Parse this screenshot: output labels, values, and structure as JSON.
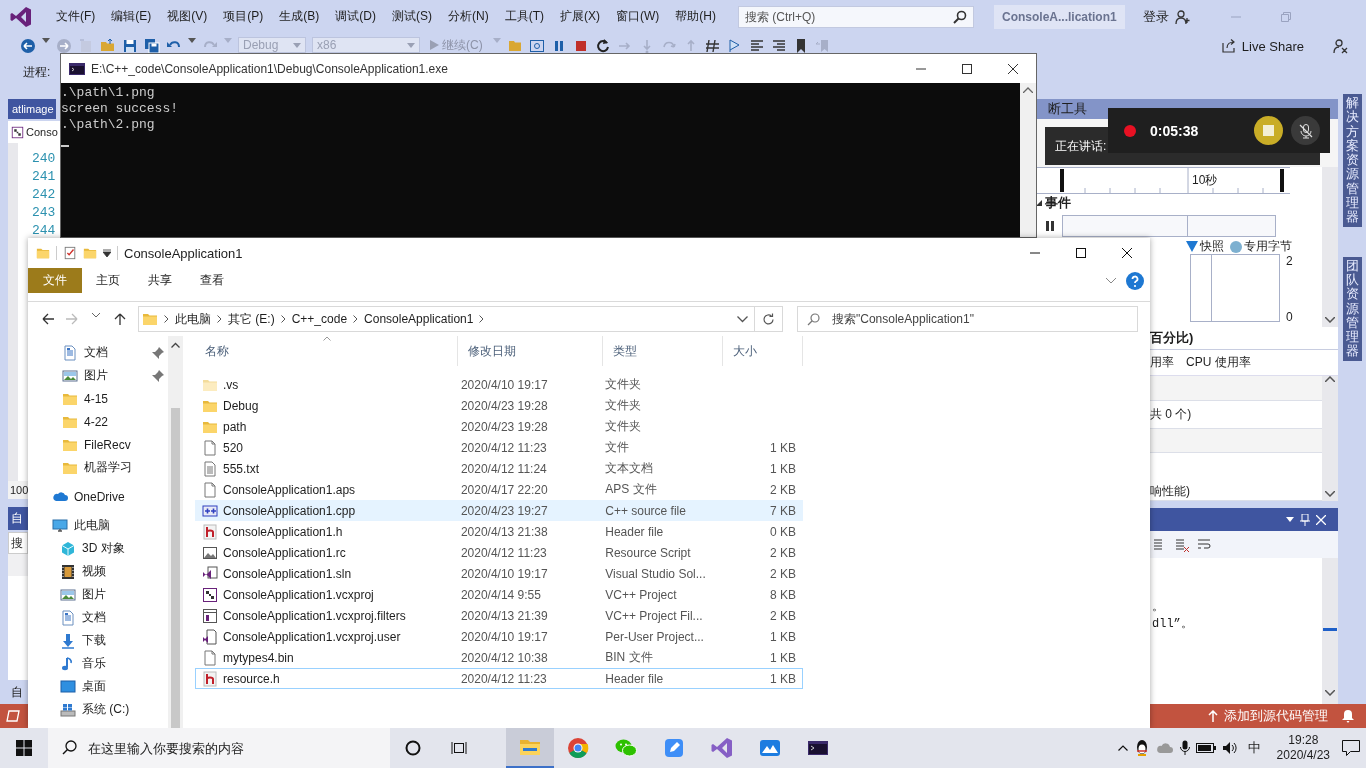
{
  "visual_studio": {
    "menu": [
      "文件(F)",
      "编辑(E)",
      "视图(V)",
      "项目(P)",
      "生成(B)",
      "调试(D)",
      "测试(S)",
      "分析(N)",
      "工具(T)",
      "扩展(X)",
      "窗口(W)",
      "帮助(H)"
    ],
    "search": {
      "placeholder": "搜索 (Ctrl+Q)"
    },
    "solution_name": "ConsoleA...lication1",
    "sign_in": "登录",
    "toolbar": {
      "configuration": {
        "value": "Debug",
        "disabled": true
      },
      "platform": {
        "value": "x86",
        "disabled": true
      },
      "continue": {
        "label": "继续(C)",
        "disabled": true
      },
      "live_share": "Live Share"
    },
    "process_label": "进程:",
    "editor": {
      "document_tab": "atlimage",
      "file_selector": "Conso",
      "line_numbers": [
        "240",
        "241",
        "242",
        "243",
        "244"
      ],
      "zoom": "100"
    },
    "autos_panel": {
      "title": "自",
      "search": {
        "placeholder": "搜"
      }
    },
    "bottom_tab": "自",
    "diagnostics": {
      "title": "断工具",
      "time_label": "10秒",
      "events_label": "事件",
      "legend": [
        {
          "label": "快照",
          "kind": "triangle",
          "color": "#1e78d2"
        },
        {
          "label": "专用字节",
          "kind": "dot",
          "color": "#7db0d0"
        }
      ],
      "axis_labels": [
        "2",
        "0"
      ],
      "section_label": "百分比)",
      "tabs": [
        "用率",
        "CPU 使用率"
      ],
      "summary": "共 0 个)",
      "footer": "响性能)"
    },
    "output_lines": [
      "。",
      "dll”。"
    ],
    "side_tabs": [
      "解决方案资源管理器",
      "团队资源管理器"
    ],
    "status": "添加到源代码管理"
  },
  "console": {
    "title": "E:\\C++_code\\ConsoleApplication1\\Debug\\ConsoleApplication1.exe",
    "lines": [
      ".\\path\\1.png",
      "screen success!",
      ".\\path\\2.png"
    ]
  },
  "recorder": {
    "speaking_label": "正在讲话:",
    "elapsed": "0:05:38",
    "recording": true,
    "mic_muted": true
  },
  "explorer": {
    "title": "ConsoleApplication1",
    "ribbon_tabs": [
      {
        "label": "文件",
        "kind": "file-menu"
      },
      {
        "label": "主页",
        "kind": "tab"
      },
      {
        "label": "共享",
        "kind": "tab"
      },
      {
        "label": "查看",
        "kind": "tab"
      }
    ],
    "address": [
      "此电脑",
      "其它 (E:)",
      "C++_code",
      "ConsoleApplication1"
    ],
    "search": {
      "placeholder": "搜索\"ConsoleApplication1\""
    },
    "quick_access": [
      {
        "label": "文档",
        "kind": "documents",
        "pinned": true
      },
      {
        "label": "图片",
        "kind": "pictures",
        "pinned": true
      },
      {
        "label": "4-15",
        "kind": "folder",
        "pinned": false
      },
      {
        "label": "4-22",
        "kind": "folder",
        "pinned": false
      },
      {
        "label": "FileRecv",
        "kind": "folder",
        "pinned": false
      },
      {
        "label": "机器学习",
        "kind": "folder",
        "pinned": false
      }
    ],
    "nav": [
      {
        "label": "OneDrive",
        "kind": "onedrive"
      },
      {
        "label": "此电脑",
        "kind": "pc",
        "children": [
          {
            "label": "3D 对象",
            "kind": "objects"
          },
          {
            "label": "视频",
            "kind": "videos"
          },
          {
            "label": "图片",
            "kind": "pictures"
          },
          {
            "label": "文档",
            "kind": "documents"
          },
          {
            "label": "下载",
            "kind": "downloads"
          },
          {
            "label": "音乐",
            "kind": "music"
          },
          {
            "label": "桌面",
            "kind": "desktop"
          },
          {
            "label": "系统 (C:)",
            "kind": "drive"
          }
        ]
      }
    ],
    "columns": [
      "名称",
      "修改日期",
      "类型",
      "大小"
    ],
    "files": [
      {
        "name": ".vs",
        "modified": "2020/4/10 19:17",
        "type": "文件夹",
        "kind": "folder-hidden",
        "selected": false,
        "focused": false
      },
      {
        "name": "Debug",
        "modified": "2020/4/23 19:28",
        "type": "文件夹",
        "kind": "folder",
        "selected": false,
        "focused": false
      },
      {
        "name": "path",
        "modified": "2020/4/23 19:28",
        "type": "文件夹",
        "kind": "folder",
        "selected": false,
        "focused": false
      },
      {
        "name": "520",
        "modified": "2020/4/12 11:23",
        "type": "文件",
        "size": "1 KB",
        "kind": "file",
        "selected": false,
        "focused": false
      },
      {
        "name": "555.txt",
        "modified": "2020/4/12 11:24",
        "type": "文本文档",
        "size": "1 KB",
        "kind": "text",
        "selected": false,
        "focused": false
      },
      {
        "name": "ConsoleApplication1.aps",
        "modified": "2020/4/17 22:20",
        "type": "APS 文件",
        "size": "2 KB",
        "kind": "file",
        "selected": false,
        "focused": false
      },
      {
        "name": "ConsoleApplication1.cpp",
        "modified": "2020/4/23 19:27",
        "type": "C++ source file",
        "size": "7 KB",
        "kind": "cpp",
        "selected": true,
        "focused": false
      },
      {
        "name": "ConsoleApplication1.h",
        "modified": "2020/4/13 21:38",
        "type": "Header file",
        "size": "0 KB",
        "kind": "header",
        "selected": false,
        "focused": false
      },
      {
        "name": "ConsoleApplication1.rc",
        "modified": "2020/4/12 11:23",
        "type": "Resource Script",
        "size": "2 KB",
        "kind": "resource",
        "selected": false,
        "focused": false
      },
      {
        "name": "ConsoleApplication1.sln",
        "modified": "2020/4/10 19:17",
        "type": "Visual Studio Sol...",
        "size": "2 KB",
        "kind": "solution",
        "selected": false,
        "focused": false
      },
      {
        "name": "ConsoleApplication1.vcxproj",
        "modified": "2020/4/14 9:55",
        "type": "VC++ Project",
        "size": "8 KB",
        "kind": "project",
        "selected": false,
        "focused": false
      },
      {
        "name": "ConsoleApplication1.vcxproj.filters",
        "modified": "2020/4/13 21:39",
        "type": "VC++ Project Fil...",
        "size": "2 KB",
        "kind": "filters",
        "selected": false,
        "focused": false
      },
      {
        "name": "ConsoleApplication1.vcxproj.user",
        "modified": "2020/4/10 19:17",
        "type": "Per-User Project...",
        "size": "1 KB",
        "kind": "user",
        "selected": false,
        "focused": false
      },
      {
        "name": "mytypes4.bin",
        "modified": "2020/4/12 10:38",
        "type": "BIN 文件",
        "size": "1 KB",
        "kind": "file",
        "selected": false,
        "focused": false
      },
      {
        "name": "resource.h",
        "modified": "2020/4/12 11:23",
        "type": "Header file",
        "size": "1 KB",
        "kind": "header",
        "selected": false,
        "focused": true
      }
    ]
  },
  "taskbar": {
    "search": {
      "placeholder": "在这里输入你要搜索的内容"
    },
    "apps": [
      {
        "kind": "file-explorer",
        "active": true
      },
      {
        "kind": "chrome",
        "active": false
      },
      {
        "kind": "wechat",
        "active": false
      },
      {
        "kind": "notes",
        "active": false
      },
      {
        "kind": "visual-studio",
        "active": false
      },
      {
        "kind": "cloud-app",
        "active": false
      },
      {
        "kind": "console",
        "active": false
      }
    ],
    "input_method": "中",
    "time": "19:28",
    "date": "2020/4/23"
  }
}
